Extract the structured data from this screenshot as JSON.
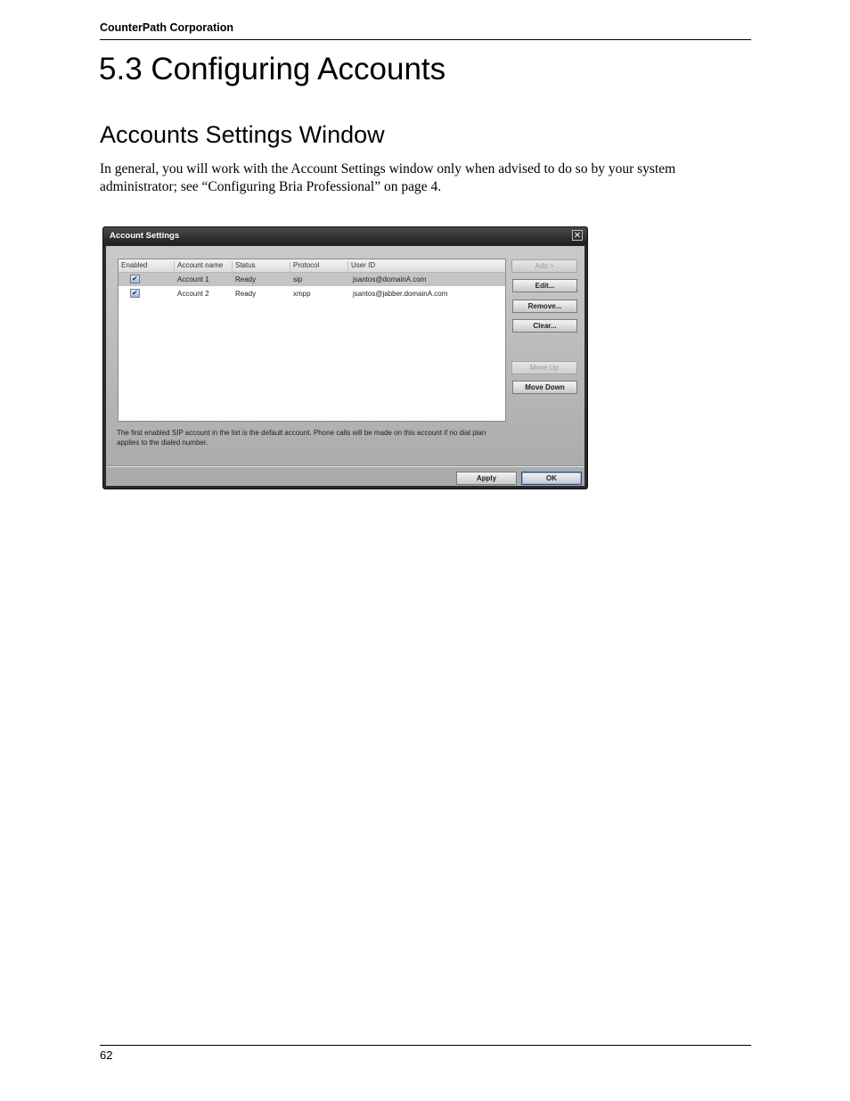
{
  "header": {
    "company": "CounterPath Corporation"
  },
  "page": {
    "title": "5.3 Configuring Accounts",
    "section_title": "Accounts Settings Window",
    "paragraph": "In general, you will work with the Account Settings window only when advised to do so by your system administrator; see “Configuring Bria Professional” on page 4."
  },
  "dialog": {
    "title": "Account Settings",
    "close_glyph": "✕",
    "columns": [
      "Enabled",
      "Account name",
      "Status",
      "Protocol",
      "User ID"
    ],
    "rows": [
      {
        "enabled": true,
        "account_name": "Account 1",
        "status": "Ready",
        "protocol": "sip",
        "user_id": "jsantos@domainA.com",
        "selected": true
      },
      {
        "enabled": true,
        "account_name": "Account 2",
        "status": "Ready",
        "protocol": "xmpp",
        "user_id": "jsantos@jabber.domainA.com",
        "selected": false
      }
    ],
    "check_glyph": "✔",
    "buttons": {
      "add": "Add >",
      "edit": "Edit...",
      "remove": "Remove...",
      "clear": "Clear...",
      "move_up": "Move Up",
      "move_down": "Move Down",
      "apply": "Apply",
      "ok": "OK"
    },
    "note": "The first enabled SIP account in the list is the default account. Phone calls will be made on this account if no dial plan applies to the dialed number."
  },
  "footer": {
    "page_number": "62"
  }
}
